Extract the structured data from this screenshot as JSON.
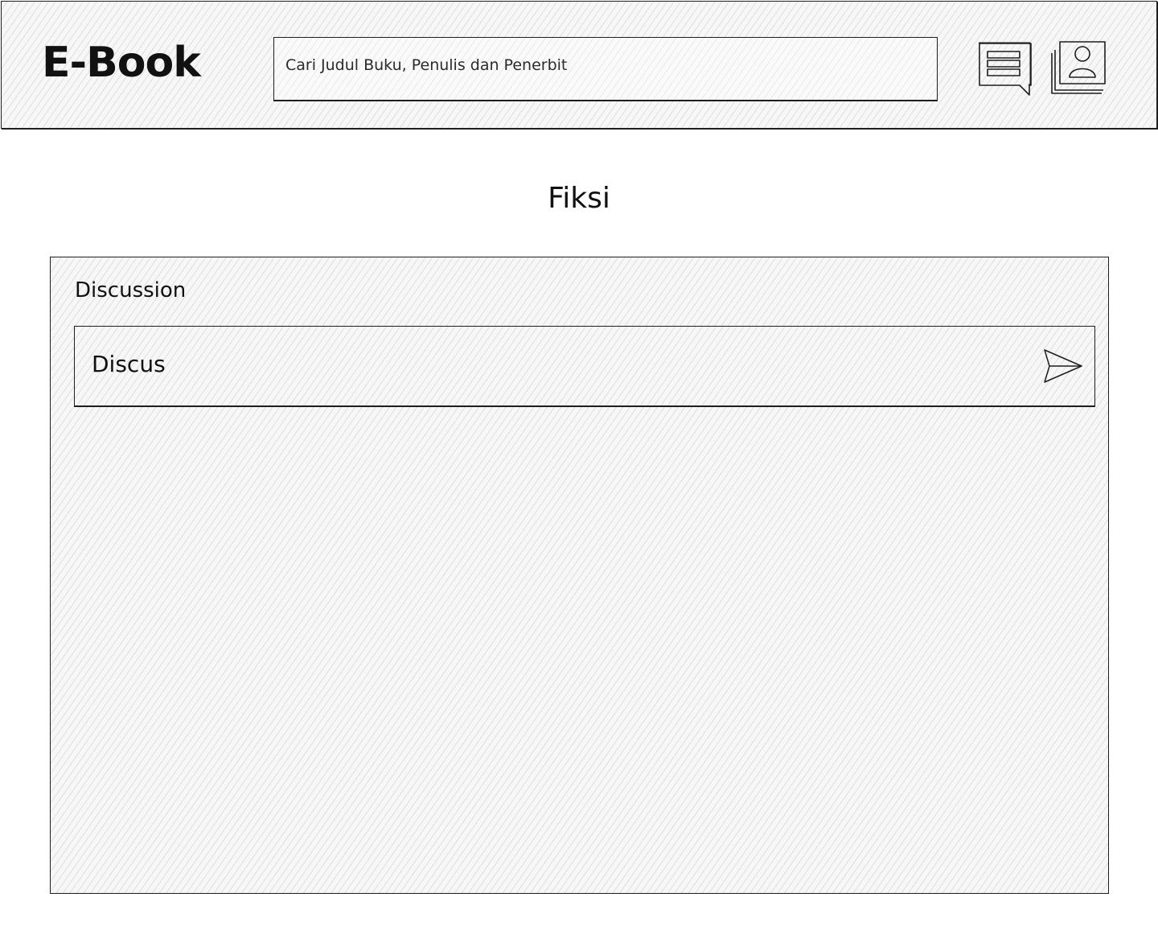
{
  "header": {
    "logo": "E-Book",
    "search": {
      "placeholder": "Cari Judul Buku, Penulis dan Penerbit"
    },
    "icons": {
      "chat": "chat-bubble-icon",
      "profile": "user-profile-icon"
    }
  },
  "main": {
    "title": "Fiksi",
    "discussion": {
      "heading": "Discussion",
      "input_placeholder": "Discus",
      "send_icon": "send-icon"
    }
  }
}
